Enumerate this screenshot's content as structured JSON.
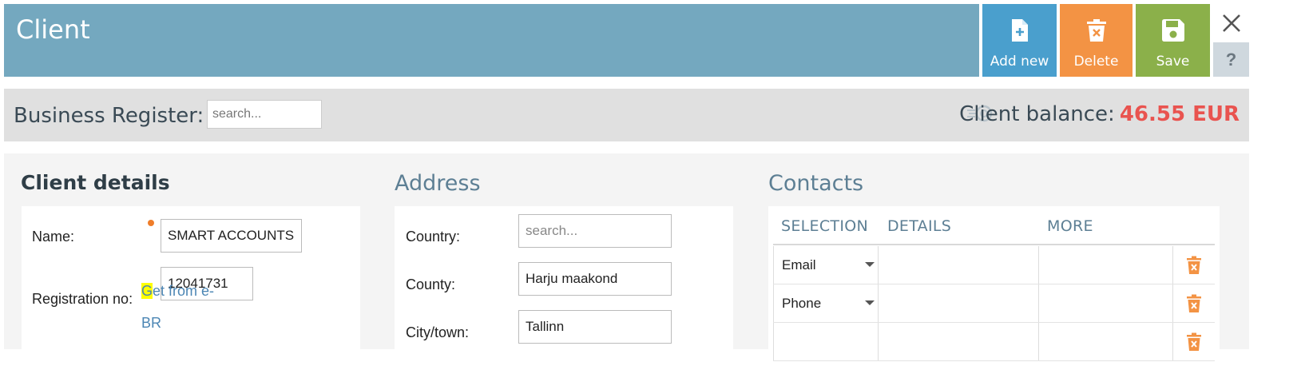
{
  "header": {
    "title": "Client",
    "buttons": {
      "add_new": "Add new",
      "delete": "Delete",
      "save": "Save"
    },
    "help": "?"
  },
  "register": {
    "label": "Business Register:",
    "search_placeholder": "search..."
  },
  "balance": {
    "label": "Client balance:",
    "amount": "46.55 EUR",
    "amount_color": "#e9534f"
  },
  "client_details": {
    "title": "Client details",
    "name_label": "Name:",
    "name_value": "SMART ACCOUNTS OÜ",
    "regno_label": "Registration no:",
    "regno_value": "12041731",
    "ebr_link_first": "G",
    "ebr_link_middle": "et from e-",
    "ebr_link_line2": "BR",
    "ebr_link_trail": " "
  },
  "address": {
    "title": "Address",
    "country_label": "Country:",
    "country_placeholder": "search...",
    "county_label": "County:",
    "county_value": "Harju maakond",
    "city_label": "City/town:",
    "city_value": "Tallinn"
  },
  "contacts": {
    "title": "Contacts",
    "columns": [
      "SELECTION",
      "DETAILS",
      "MORE"
    ],
    "rows": [
      {
        "type": "Email"
      },
      {
        "type": "Phone"
      },
      {
        "type": ""
      }
    ]
  },
  "colors": {
    "header": "#74a8bf",
    "add_new": "#4a9fcd",
    "delete": "#f39344",
    "save": "#8bb04a"
  },
  "icons": {
    "add_new": "file-plus-icon",
    "delete": "trash-icon",
    "save": "floppy-disk-icon",
    "close": "close-icon",
    "balance": "coins-icon"
  }
}
